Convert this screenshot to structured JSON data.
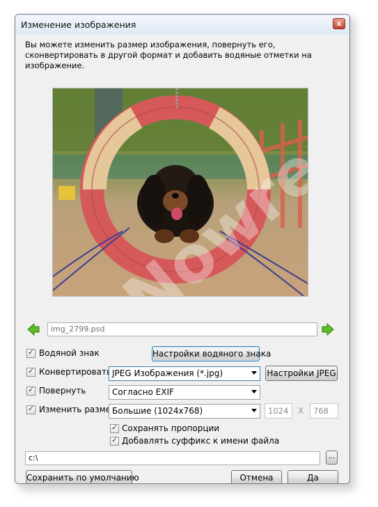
{
  "window": {
    "title": "Изменение изображения",
    "close_glyph": "x"
  },
  "description": "Вы можете изменить размер изображения, повернуть его, сконвертировать в другой формат и добавить водяные отметки на изображение.",
  "preview": {
    "watermark_text": "Nowrep"
  },
  "navigation": {
    "prev_icon": "arrow-left-icon",
    "next_icon": "arrow-right-icon",
    "filename": "img_2799.psd"
  },
  "options": {
    "watermark": {
      "label": "Водяной знак",
      "checked": true,
      "button": "Настройки водяного знака"
    },
    "convert": {
      "label": "Конвертировать",
      "checked": true,
      "format": "JPEG Изображения  (*.jpg)",
      "button": "Настройки JPEG"
    },
    "rotate": {
      "label": "Повернуть",
      "checked": true,
      "mode": "Согласно EXIF"
    },
    "resize": {
      "label": "Изменить размер",
      "checked": true,
      "size": "Большие (1024x768)",
      "width": "1024",
      "x_sep": "X",
      "height": "768"
    },
    "keep_proportions": {
      "label": "Сохранять пропорции",
      "checked": true
    },
    "add_suffix": {
      "label": "Добавлять суффикс к имени файла",
      "checked": true
    }
  },
  "output": {
    "path": "c:\\",
    "browse_label": "..."
  },
  "footer": {
    "save_default": "Сохранить по умолчанию",
    "cancel": "Отмена",
    "ok": "Да"
  },
  "colors": {
    "arrow_green": "#4caf1f",
    "focus_border": "#3c7fb1"
  }
}
